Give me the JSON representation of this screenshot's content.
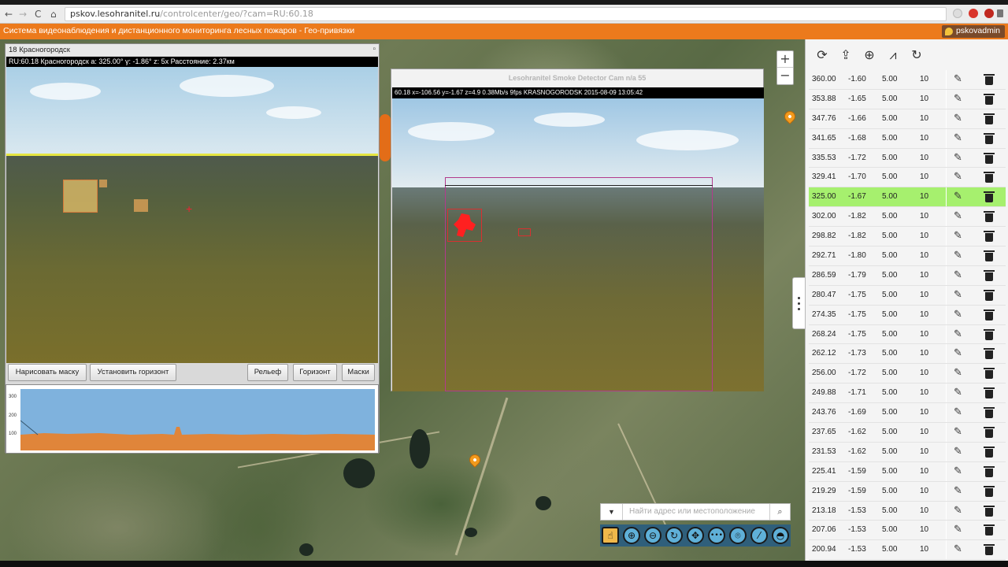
{
  "browser": {
    "back": "←",
    "forward": "→",
    "reload": "C",
    "home": "⌂",
    "url_host": "pskov.lesohranitel.ru",
    "url_path": "/controlcenter/geo/?cam=RU:60.18"
  },
  "app": {
    "title": "Система видеонаблюдения и дистанционного мониторинга лесных пожаров - Гео-привязки",
    "user": "pskovadmin"
  },
  "camera_panel": {
    "title": "18 Красногородск",
    "close": "▫",
    "osd": "RU:60.18 Красногородск a: 325.00° γ: -1.86° z: 5x Расстояние: 2.37км",
    "buttons": {
      "draw_mask": "Нарисовать маску",
      "set_horizon": "Установить горизонт",
      "relief": "Рельеф",
      "horizon": "Горизонт",
      "masks": "Маски"
    },
    "profile_axis": [
      "300",
      "200",
      "100"
    ]
  },
  "smoke_panel": {
    "title": "Lesohranitel Smoke Detector Cam n/a 55",
    "osd": "60.18 x=-106.56 y=-1.67 z=4.9 0.38Mb/s 9fps KRASNOGORODSK 2015-08-09 13:05:42"
  },
  "map": {
    "zoom_in": "+",
    "zoom_out": "−",
    "search_placeholder": "Найти адрес или местоположение",
    "search_button": "⌕",
    "dropdown": "▼",
    "tools": [
      "☝",
      "⊕",
      "⊖",
      "↻",
      "✥",
      "•••",
      "⌾",
      "⁄",
      "◓"
    ]
  },
  "right_panel": {
    "toolbar_icons": [
      "refresh-icon",
      "upload-icon",
      "target-icon",
      "chart-icon",
      "rotate-icon"
    ],
    "toolbar_glyphs": [
      "⟳",
      "⇪",
      "⊕",
      "⩘",
      "↻"
    ],
    "selected_index": 6,
    "rows": [
      [
        "360.00",
        "-1.60",
        "5.00",
        "10"
      ],
      [
        "353.88",
        "-1.65",
        "5.00",
        "10"
      ],
      [
        "347.76",
        "-1.66",
        "5.00",
        "10"
      ],
      [
        "341.65",
        "-1.68",
        "5.00",
        "10"
      ],
      [
        "335.53",
        "-1.72",
        "5.00",
        "10"
      ],
      [
        "329.41",
        "-1.70",
        "5.00",
        "10"
      ],
      [
        "325.00",
        "-1.67",
        "5.00",
        "10"
      ],
      [
        "302.00",
        "-1.82",
        "5.00",
        "10"
      ],
      [
        "298.82",
        "-1.82",
        "5.00",
        "10"
      ],
      [
        "292.71",
        "-1.80",
        "5.00",
        "10"
      ],
      [
        "286.59",
        "-1.79",
        "5.00",
        "10"
      ],
      [
        "280.47",
        "-1.75",
        "5.00",
        "10"
      ],
      [
        "274.35",
        "-1.75",
        "5.00",
        "10"
      ],
      [
        "268.24",
        "-1.75",
        "5.00",
        "10"
      ],
      [
        "262.12",
        "-1.73",
        "5.00",
        "10"
      ],
      [
        "256.00",
        "-1.72",
        "5.00",
        "10"
      ],
      [
        "249.88",
        "-1.71",
        "5.00",
        "10"
      ],
      [
        "243.76",
        "-1.69",
        "5.00",
        "10"
      ],
      [
        "237.65",
        "-1.62",
        "5.00",
        "10"
      ],
      [
        "231.53",
        "-1.62",
        "5.00",
        "10"
      ],
      [
        "225.41",
        "-1.59",
        "5.00",
        "10"
      ],
      [
        "219.29",
        "-1.59",
        "5.00",
        "10"
      ],
      [
        "213.18",
        "-1.53",
        "5.00",
        "10"
      ],
      [
        "207.06",
        "-1.53",
        "5.00",
        "10"
      ],
      [
        "200.94",
        "-1.53",
        "5.00",
        "10"
      ]
    ]
  },
  "colors": {
    "accent": "#ec7a1c",
    "selected_row": "#a6f06e",
    "detection": "#ff2020"
  }
}
